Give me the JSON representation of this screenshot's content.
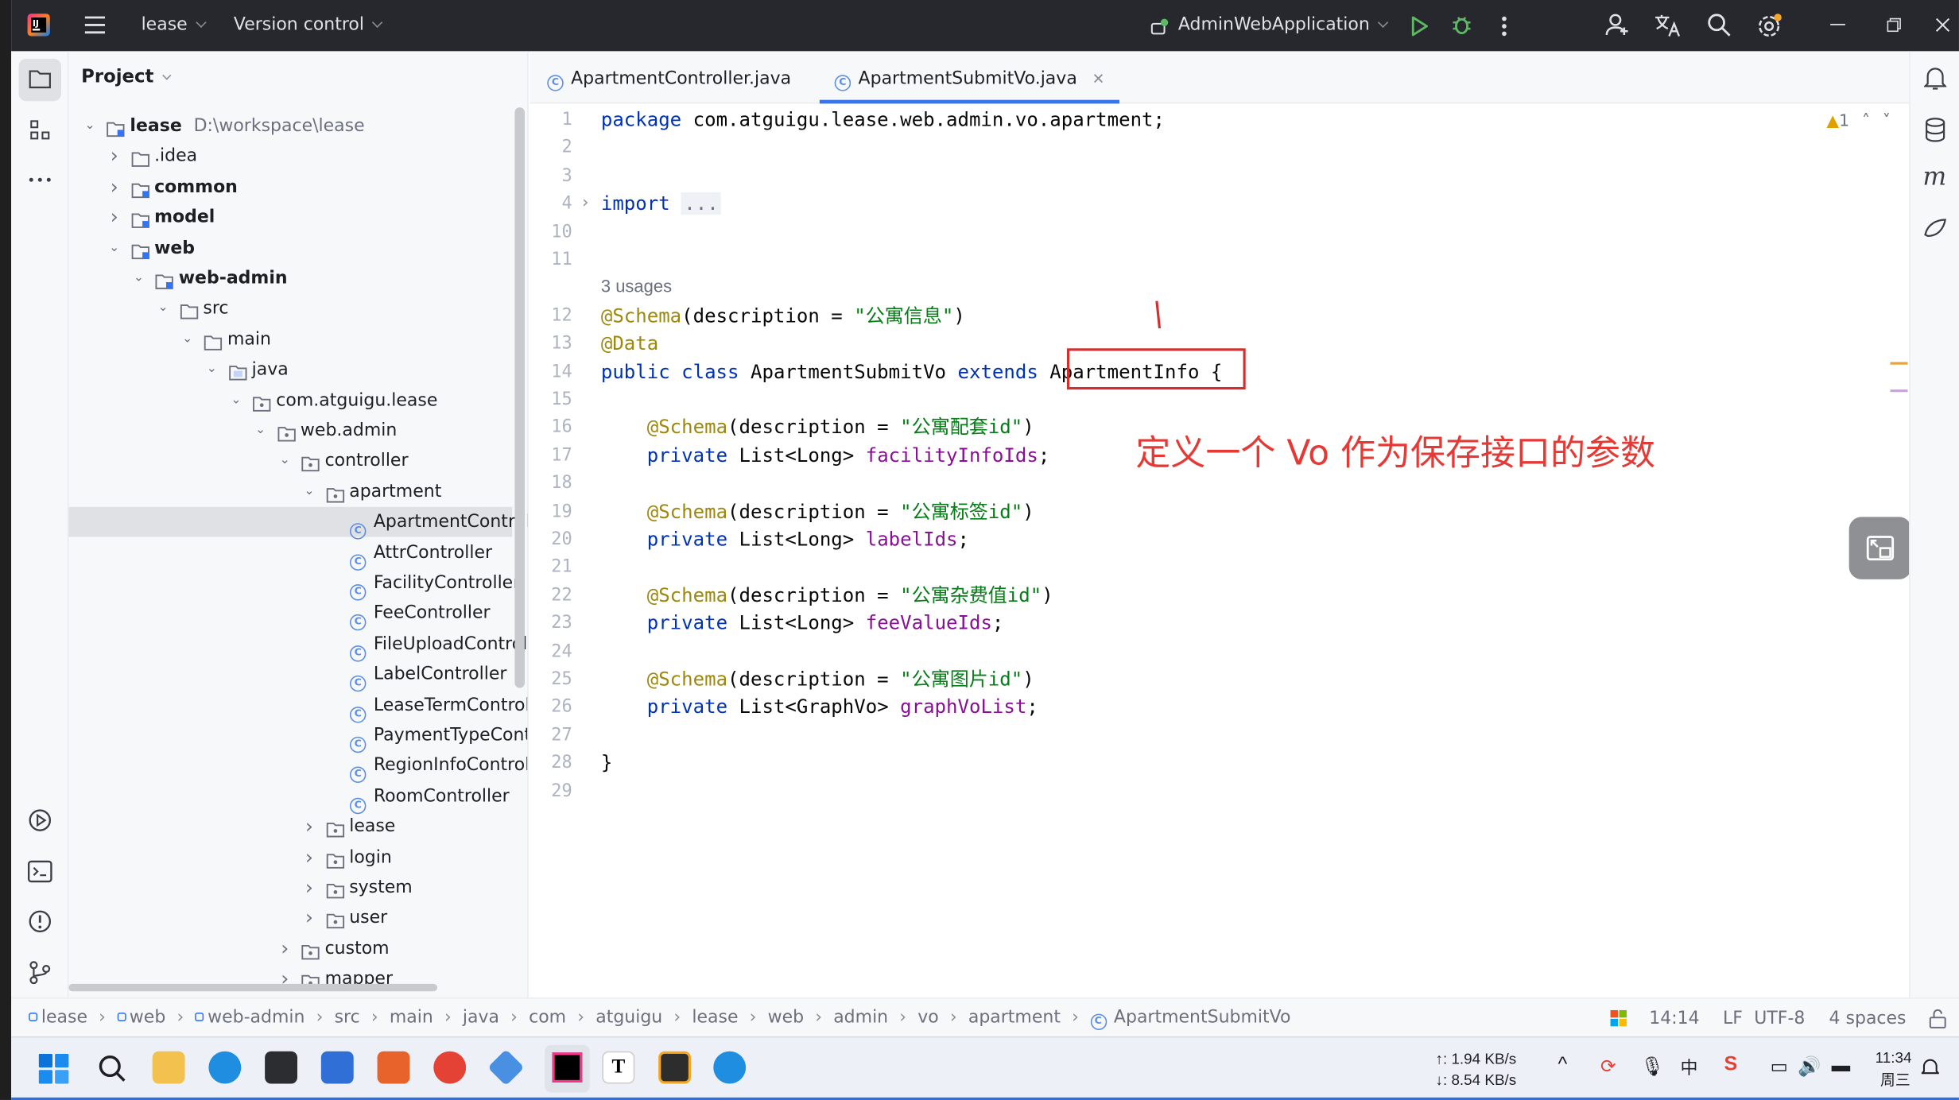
{
  "titlebar": {
    "project": "lease",
    "vcs": "Version control",
    "run_config": "AdminWebApplication"
  },
  "project_panel": {
    "title": "Project",
    "tree": [
      {
        "label": "lease",
        "path": "D:\\workspace\\lease",
        "indent": 0,
        "arrow": "down",
        "bold": true,
        "icon": "module-folder-icon"
      },
      {
        "label": ".idea",
        "indent": 1,
        "arrow": "right",
        "icon": "folder-icon"
      },
      {
        "label": "common",
        "indent": 1,
        "arrow": "right",
        "bold": true,
        "icon": "module-folder-icon"
      },
      {
        "label": "model",
        "indent": 1,
        "arrow": "right",
        "bold": true,
        "icon": "module-folder-icon"
      },
      {
        "label": "web",
        "indent": 1,
        "arrow": "down",
        "bold": true,
        "icon": "module-folder-icon"
      },
      {
        "label": "web-admin",
        "indent": 2,
        "arrow": "down",
        "bold": true,
        "icon": "module-folder-icon"
      },
      {
        "label": "src",
        "indent": 3,
        "arrow": "down",
        "icon": "folder-icon"
      },
      {
        "label": "main",
        "indent": 4,
        "arrow": "down",
        "icon": "folder-icon"
      },
      {
        "label": "java",
        "indent": 5,
        "arrow": "down",
        "icon": "source-folder-icon"
      },
      {
        "label": "com.atguigu.lease",
        "indent": 6,
        "arrow": "down",
        "icon": "package-icon"
      },
      {
        "label": "web.admin",
        "indent": 7,
        "arrow": "down",
        "icon": "package-icon"
      },
      {
        "label": "controller",
        "indent": 8,
        "arrow": "down",
        "icon": "package-icon"
      },
      {
        "label": "apartment",
        "indent": 9,
        "arrow": "down",
        "icon": "package-icon"
      },
      {
        "label": "ApartmentControll",
        "indent": 10,
        "icon": "class-icon",
        "selected": true
      },
      {
        "label": "AttrController",
        "indent": 10,
        "icon": "class-icon"
      },
      {
        "label": "FacilityController",
        "indent": 10,
        "icon": "class-icon"
      },
      {
        "label": "FeeController",
        "indent": 10,
        "icon": "class-icon"
      },
      {
        "label": "FileUploadControll",
        "indent": 10,
        "icon": "class-icon"
      },
      {
        "label": "LabelController",
        "indent": 10,
        "icon": "class-icon"
      },
      {
        "label": "LeaseTermControl",
        "indent": 10,
        "icon": "class-icon"
      },
      {
        "label": "PaymentTypeCont",
        "indent": 10,
        "icon": "class-icon"
      },
      {
        "label": "RegionInfoControll",
        "indent": 10,
        "icon": "class-icon"
      },
      {
        "label": "RoomController",
        "indent": 10,
        "icon": "class-icon"
      },
      {
        "label": "lease",
        "indent": 9,
        "arrow": "right",
        "icon": "package-icon"
      },
      {
        "label": "login",
        "indent": 9,
        "arrow": "right",
        "icon": "package-icon"
      },
      {
        "label": "system",
        "indent": 9,
        "arrow": "right",
        "icon": "package-icon"
      },
      {
        "label": "user",
        "indent": 9,
        "arrow": "right",
        "icon": "package-icon"
      },
      {
        "label": "custom",
        "indent": 8,
        "arrow": "right",
        "icon": "package-icon"
      },
      {
        "label": "mapper",
        "indent": 8,
        "arrow": "right",
        "icon": "package-icon"
      }
    ]
  },
  "tabs": [
    {
      "label": "ApartmentController.java",
      "active": false
    },
    {
      "label": "ApartmentSubmitVo.java",
      "active": true
    }
  ],
  "editor": {
    "warnings": "1",
    "usages": "3 usages",
    "lines": [
      {
        "n": "1",
        "tokens": [
          [
            "kw",
            "package "
          ],
          [
            "",
            "com.atguigu.lease.web.admin.vo.apartment;"
          ]
        ]
      },
      {
        "n": "2",
        "tokens": []
      },
      {
        "n": "3",
        "tokens": []
      },
      {
        "n": "4",
        "tokens": [
          [
            "kw",
            "import "
          ],
          [
            "gr",
            "..."
          ]
        ]
      },
      {
        "n": "10",
        "tokens": []
      },
      {
        "n": "11",
        "tokens": []
      },
      {
        "n": "12",
        "tokens": [
          [
            "ann",
            "@Schema"
          ],
          [
            "",
            "(description = "
          ],
          [
            "str",
            "\"公寓信息\""
          ],
          [
            "",
            ")"
          ]
        ]
      },
      {
        "n": "13",
        "tokens": [
          [
            "ann",
            "@Data"
          ]
        ]
      },
      {
        "n": "14",
        "tokens": [
          [
            "kw",
            "public class "
          ],
          [
            "",
            "ApartmentSubmitVo "
          ],
          [
            "kw",
            "extends "
          ],
          [
            "",
            "ApartmentInfo {"
          ]
        ]
      },
      {
        "n": "15",
        "tokens": []
      },
      {
        "n": "16",
        "tokens": [
          [
            "",
            "    "
          ],
          [
            "ann",
            "@Schema"
          ],
          [
            "",
            "(description = "
          ],
          [
            "str",
            "\"公寓配套id\""
          ],
          [
            "",
            ")"
          ]
        ]
      },
      {
        "n": "17",
        "tokens": [
          [
            "",
            "    "
          ],
          [
            "kw",
            "private "
          ],
          [
            "",
            "List<Long> "
          ],
          [
            "fld",
            "facilityInfoIds"
          ],
          [
            "",
            ";"
          ]
        ]
      },
      {
        "n": "18",
        "tokens": []
      },
      {
        "n": "19",
        "tokens": [
          [
            "",
            "    "
          ],
          [
            "ann",
            "@Schema"
          ],
          [
            "",
            "(description = "
          ],
          [
            "str",
            "\"公寓标签id\""
          ],
          [
            "",
            ")"
          ]
        ]
      },
      {
        "n": "20",
        "tokens": [
          [
            "",
            "    "
          ],
          [
            "kw",
            "private "
          ],
          [
            "",
            "List<Long> "
          ],
          [
            "fld",
            "labelIds"
          ],
          [
            "",
            ";"
          ]
        ]
      },
      {
        "n": "21",
        "tokens": []
      },
      {
        "n": "22",
        "tokens": [
          [
            "",
            "    "
          ],
          [
            "ann",
            "@Schema"
          ],
          [
            "",
            "(description = "
          ],
          [
            "str",
            "\"公寓杂费值id\""
          ],
          [
            "",
            ")"
          ]
        ]
      },
      {
        "n": "23",
        "tokens": [
          [
            "",
            "    "
          ],
          [
            "kw",
            "private "
          ],
          [
            "",
            "List<Long> "
          ],
          [
            "fld",
            "feeValueIds"
          ],
          [
            "",
            ";"
          ]
        ]
      },
      {
        "n": "24",
        "tokens": []
      },
      {
        "n": "25",
        "tokens": [
          [
            "",
            "    "
          ],
          [
            "ann",
            "@Schema"
          ],
          [
            "",
            "(description = "
          ],
          [
            "str",
            "\"公寓图片id\""
          ],
          [
            "",
            ")"
          ]
        ]
      },
      {
        "n": "26",
        "tokens": [
          [
            "",
            "    "
          ],
          [
            "kw",
            "private "
          ],
          [
            "",
            "List<GraphVo> "
          ],
          [
            "fld",
            "graphVoList"
          ],
          [
            "",
            ";"
          ]
        ]
      },
      {
        "n": "27",
        "tokens": []
      },
      {
        "n": "28",
        "tokens": [
          [
            "",
            "}"
          ]
        ]
      },
      {
        "n": "29",
        "tokens": []
      }
    ],
    "annotation_note": "定义一个 Vo 作为保存接口的参数"
  },
  "breadcrumb": [
    "lease",
    "web",
    "web-admin",
    "src",
    "main",
    "java",
    "com",
    "atguigu",
    "lease",
    "web",
    "admin",
    "vo",
    "apartment",
    "ApartmentSubmitVo"
  ],
  "status": {
    "position": "14:14",
    "line_sep": "LF",
    "encoding": "UTF-8",
    "indent": "4 spaces"
  },
  "taskbar": {
    "net_up": "↑: 1.94 KB/s",
    "net_down": "↓: 8.54 KB/s",
    "time": "11:34",
    "day": "周三"
  },
  "colors": {
    "accent": "#3574f0",
    "highlight_box": "#d32f2f",
    "note_red": "#e53935"
  }
}
